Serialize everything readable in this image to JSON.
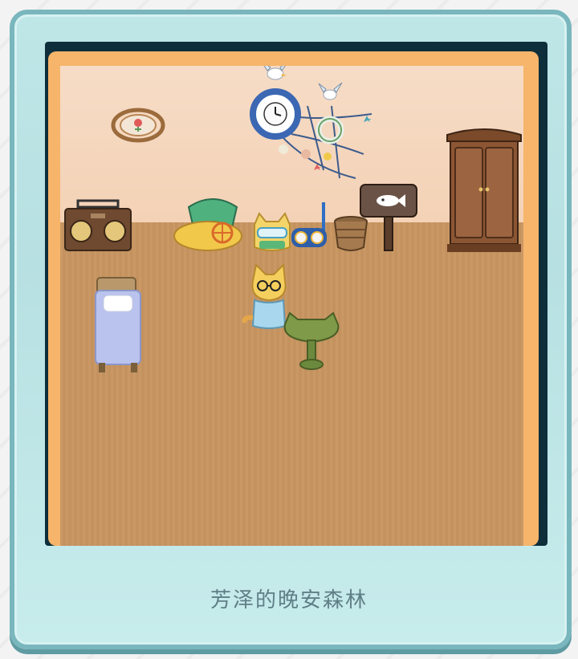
{
  "caption": "芳泽的晚安森林",
  "colors": {
    "card_bg": "#bfe6e7",
    "card_border": "#79b6bd",
    "frame_dark": "#0e2e3c",
    "wall": "#f4d2b6",
    "floor": "#c79560",
    "wall_trim": "#f6b56b",
    "caption_text": "#5f7f86"
  },
  "scene": {
    "items": [
      {
        "name": "flower-wall-frame-icon"
      },
      {
        "name": "ship-wheel-clock-decoration-icon"
      },
      {
        "name": "seagull-icon"
      },
      {
        "name": "boombox-radio-icon"
      },
      {
        "name": "beach-cradle-icon"
      },
      {
        "name": "cat-plush-goggles-icon"
      },
      {
        "name": "snorkel-goggles-icon"
      },
      {
        "name": "woven-basket-icon"
      },
      {
        "name": "fish-signpost-icon"
      },
      {
        "name": "wooden-wardrobe-icon"
      },
      {
        "name": "single-bed-icon"
      },
      {
        "name": "cat-character-icon"
      },
      {
        "name": "cat-table-icon"
      }
    ]
  }
}
